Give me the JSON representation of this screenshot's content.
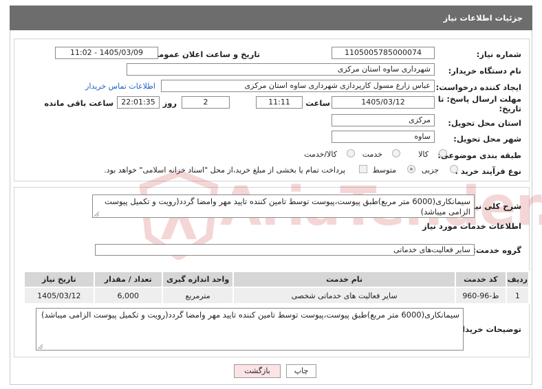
{
  "header": {
    "title": "جزئیات اطلاعات نیاز"
  },
  "form": {
    "need_number_label": "شماره نیاز:",
    "need_number": "1105005785000074",
    "announce_label": "تاریخ و ساعت اعلان عمومی:",
    "announce_value": "1405/03/09 - 11:02",
    "buyer_org_label": "نام دستگاه خریدار:",
    "buyer_org": "شهرداری ساوه استان مرکزی",
    "creator_label": "ایجاد کننده درخواست:",
    "creator": "عباس زارع مسول کارپردازی شهرداری ساوه استان مرکزی",
    "contact_link": "اطلاعات تماس خریدار",
    "deadline_label_1": "مهلت ارسال پاسخ: تا",
    "deadline_label_2": "تاریخ:",
    "deadline_date": "1405/03/12",
    "time_label": "ساعت",
    "deadline_time": "11:11",
    "days_value": "2",
    "days_label": "روز و",
    "remaining_time": "22:01:35",
    "remaining_label": "ساعت باقی مانده",
    "province_label": "استان محل تحویل:",
    "province": "مرکزی",
    "city_label": "شهر محل تحویل:",
    "city": "ساوه",
    "category_label": "طبقه بندی موضوعی:",
    "category_options": [
      "کالا",
      "خدمت",
      "کالا/خدمت"
    ],
    "process_label": "نوع فرآیند خرید :",
    "process_options": [
      "جزیی",
      "متوسط"
    ],
    "payment_note": "پرداخت تمام یا بخشی از مبلغ خرید،از محل \"اسناد خزانه اسلامی\" خواهد بود."
  },
  "description": {
    "label": "شرح کلی نیاز:",
    "text": "سیمانکاری(6000 متر مربع)طبق پیوست،پیوست توسط تامین کننده تایید مهر وامضا گردد(رویت و تکمیل پیوست الزامی میباشد)"
  },
  "services": {
    "section_title": "اطلاعات خدمات مورد نیاز",
    "group_label": "گروه خدمت:",
    "group_value": "سایر فعالیت‌های خدماتی",
    "columns": [
      "ردیف",
      "کد خدمت",
      "نام خدمت",
      "واحد اندازه گیری",
      "تعداد / مقدار",
      "تاریخ نیاز"
    ],
    "rows": [
      [
        "1",
        "ط-96-960",
        "سایر فعالیت های خدماتی شخصی",
        "مترمربع",
        "6,000",
        "1405/03/12"
      ]
    ]
  },
  "buyer_notes": {
    "label": "توضیحات خریدار:",
    "text": "سیمانکاری(6000 متر مربع)طبق پیوست،پیوست توسط تامین کننده تایید مهر وامضا گردد(رویت و تکمیل پیوست الزامی میباشد)"
  },
  "buttons": {
    "print": "چاپ",
    "back": "بازگشت"
  },
  "watermark": {
    "text": "AriaTender.neT"
  },
  "colors": {
    "header_bg": "#6d6d6d",
    "link": "#1d5fc4",
    "back_btn_bg": "#fbe3e6",
    "watermark": "#c42424"
  }
}
